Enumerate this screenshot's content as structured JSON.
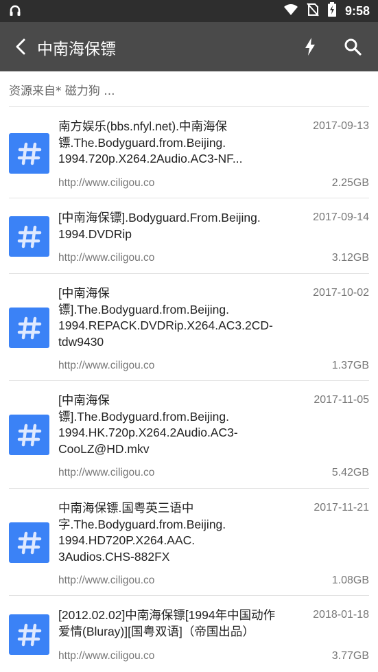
{
  "status_bar": {
    "time": "9:58",
    "left_icon": "headset-icon",
    "icons": [
      "wifi-icon",
      "no-sim-icon",
      "battery-charging-icon"
    ]
  },
  "app_bar": {
    "title": "中南海保镖",
    "back_icon": "back-arrow-icon",
    "actions": [
      "bolt-icon",
      "search-icon"
    ]
  },
  "source_text": "资源来自* 磁力狗 ...",
  "accent_color": "#3b82f6",
  "results": [
    {
      "name_lines": [
        "南方娱乐(bbs.nfyl.net).中南海保",
        "镖.The.Bodyguard.from.Beijing.",
        "1994.720p.X264.2Audio.AC3-NF..."
      ],
      "date": "2017-09-13",
      "url": "http://www.ciligou.co",
      "size": "2.25GB"
    },
    {
      "name_lines": [
        "[中南海保镖].Bodyguard.From.Beijing.",
        "1994.DVDRip"
      ],
      "date": "2017-09-14",
      "url": "http://www.ciligou.co",
      "size": "3.12GB"
    },
    {
      "name_lines": [
        "[中南海保",
        "镖].The.Bodyguard.from.Beijing.",
        "1994.REPACK.DVDRip.X264.AC3.2CD-",
        "tdw9430"
      ],
      "date": "2017-10-02",
      "url": "http://www.ciligou.co",
      "size": "1.37GB"
    },
    {
      "name_lines": [
        "[中南海保",
        "镖].The.Bodyguard.from.Beijing.",
        "1994.HK.720p.X264.2Audio.AC3-",
        "CooLZ@HD.mkv"
      ],
      "date": "2017-11-05",
      "url": "http://www.ciligou.co",
      "size": "5.42GB"
    },
    {
      "name_lines": [
        "中南海保镖.国粤英三语中",
        "字.The.Bodyguard.from.Beijing.",
        "1994.HD720P.X264.AAC.",
        "3Audios.CHS-882FX"
      ],
      "date": "2017-11-21",
      "url": "http://www.ciligou.co",
      "size": "1.08GB"
    },
    {
      "name_lines": [
        "[2012.02.02]中南海保镖[1994年中国动作",
        "爱情(Bluray)][国粤双语]（帝国出品）"
      ],
      "date": "2018-01-18",
      "url": "http://www.ciligou.co",
      "size": "3.77GB"
    }
  ]
}
